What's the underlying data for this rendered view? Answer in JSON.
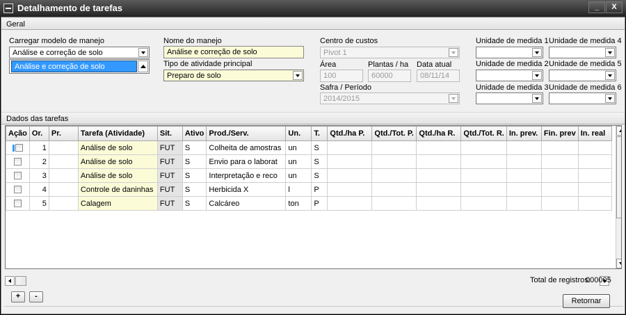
{
  "window": {
    "title": "Detalhamento de tarefas",
    "minimize": "_",
    "close": "X"
  },
  "geral": {
    "header": "Geral",
    "carregar_modelo": {
      "label": "Carregar modelo de manejo",
      "value": "Análise e correção de solo",
      "list_selected": "Análise e correção de solo"
    },
    "nome_manejo": {
      "label": "Nome do manejo",
      "value": "Análise e correção de solo"
    },
    "tipo_atividade": {
      "label": "Tipo de atividade principal",
      "value": "Preparo de solo"
    },
    "centro_custos": {
      "label": "Centro de custos",
      "value": "Pivot 1"
    },
    "area": {
      "label": "Área",
      "value": "100"
    },
    "plantas_ha": {
      "label": "Plantas / ha",
      "value": "60000"
    },
    "data_atual": {
      "label": "Data atual",
      "value": "08/11/14"
    },
    "safra": {
      "label": "Safra / Período",
      "value": "2014/2015"
    },
    "unidades": [
      {
        "label": "Unidade de medida 1",
        "value": ""
      },
      {
        "label": "Unidade de medida 2",
        "value": ""
      },
      {
        "label": "Unidade de medida 3",
        "value": ""
      },
      {
        "label": "Unidade de medida 4",
        "value": ""
      },
      {
        "label": "Unidade de medida 5",
        "value": ""
      },
      {
        "label": "Unidade de medida 6",
        "value": ""
      }
    ]
  },
  "tarefas": {
    "header": "Dados das tarefas",
    "columns": [
      "Ação",
      "Or.",
      "Pr.",
      "Tarefa (Atividade)",
      "Sit.",
      "Ativo",
      "Prod./Serv.",
      "Un.",
      "T.",
      "Qtd./ha P.",
      "Qtd./Tot. P.",
      "Qtd./ha R.",
      "Qtd./Tot. R.",
      "In. prev.",
      "Fin. prev",
      "In. real"
    ],
    "rows": [
      {
        "or": "1",
        "pr": "",
        "tarefa": "Análise de solo",
        "sit": "FUT",
        "ativo": "S",
        "prod": "Colheita de amostras",
        "un": "un",
        "t": "S"
      },
      {
        "or": "2",
        "pr": "",
        "tarefa": "Análise de solo",
        "sit": "FUT",
        "ativo": "S",
        "prod": "Envio para o laborat",
        "un": "un",
        "t": "S"
      },
      {
        "or": "3",
        "pr": "",
        "tarefa": "Análise de solo",
        "sit": "FUT",
        "ativo": "S",
        "prod": "Interpretação e reco",
        "un": "un",
        "t": "S"
      },
      {
        "or": "4",
        "pr": "",
        "tarefa": "Controle de daninhas",
        "sit": "FUT",
        "ativo": "S",
        "prod": "Herbicida X",
        "un": "l",
        "t": "P"
      },
      {
        "or": "5",
        "pr": "",
        "tarefa": "Calagem",
        "sit": "FUT",
        "ativo": "S",
        "prod": "Calcáreo",
        "un": "ton",
        "t": "P"
      }
    ],
    "add_label": "+",
    "remove_label": "-",
    "total_label": "Total de registros:",
    "total_value": "000005"
  },
  "retornar_label": "Retornar"
}
